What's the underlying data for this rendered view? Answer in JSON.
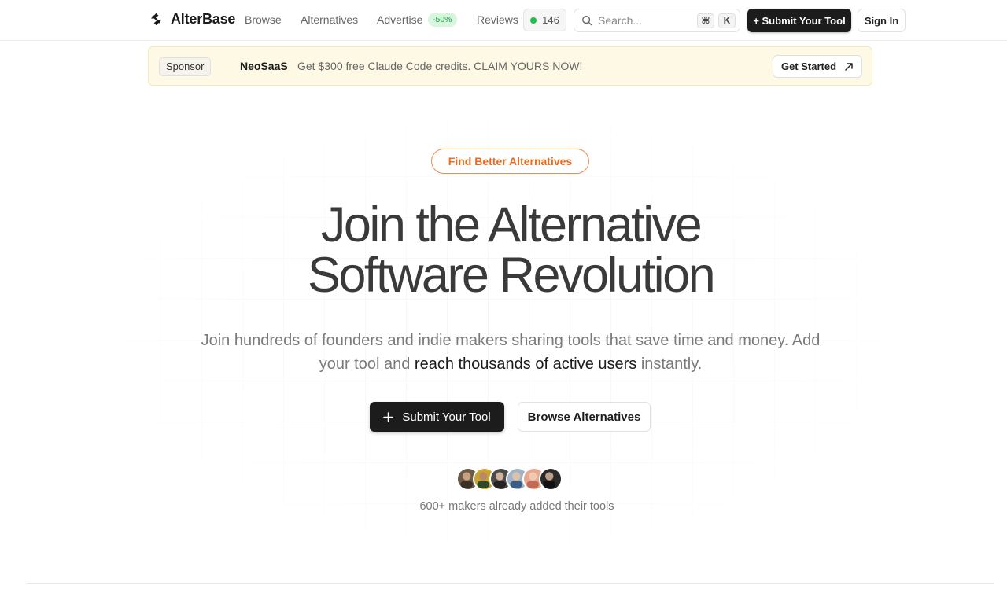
{
  "header": {
    "brand": "AlterBase",
    "nav": [
      {
        "label": "Browse"
      },
      {
        "label": "Alternatives"
      },
      {
        "label": "Advertise",
        "badge": "-50%"
      },
      {
        "label": "Reviews"
      }
    ],
    "count": "146",
    "search_placeholder": "Search...",
    "shortcut_keys": [
      "⌘",
      "K"
    ],
    "submit_label": "+ Submit Your Tool",
    "signin_label": "Sign In"
  },
  "sponsor": {
    "tag": "Sponsor",
    "name": "NeoSaaS",
    "text": "Get $300 free Claude Code credits. CLAIM YOURS NOW!",
    "cta": "Get Started"
  },
  "hero": {
    "pill": "Find Better Alternatives",
    "title_line1": "Join the Alternative",
    "title_line2": "Software Revolution",
    "subtitle_part1": "Join hundreds of founders and indie makers sharing tools that save time and money. Add your tool and ",
    "subtitle_highlight": "reach thousands of active users",
    "subtitle_part2": " instantly.",
    "primary_cta": "Submit Your Tool",
    "secondary_cta": "Browse Alternatives",
    "makers_text": "600+ makers already added their tools",
    "avatars": [
      "maker-avatar-1",
      "maker-avatar-2",
      "maker-avatar-3",
      "maker-avatar-4",
      "maker-avatar-5",
      "maker-avatar-6"
    ]
  },
  "colors": {
    "accent_orange": "#ea6a1f",
    "dark_button": "#1c1c1c",
    "status_green": "#1fbf4e",
    "sponsor_bg": "#fdf9e4"
  }
}
